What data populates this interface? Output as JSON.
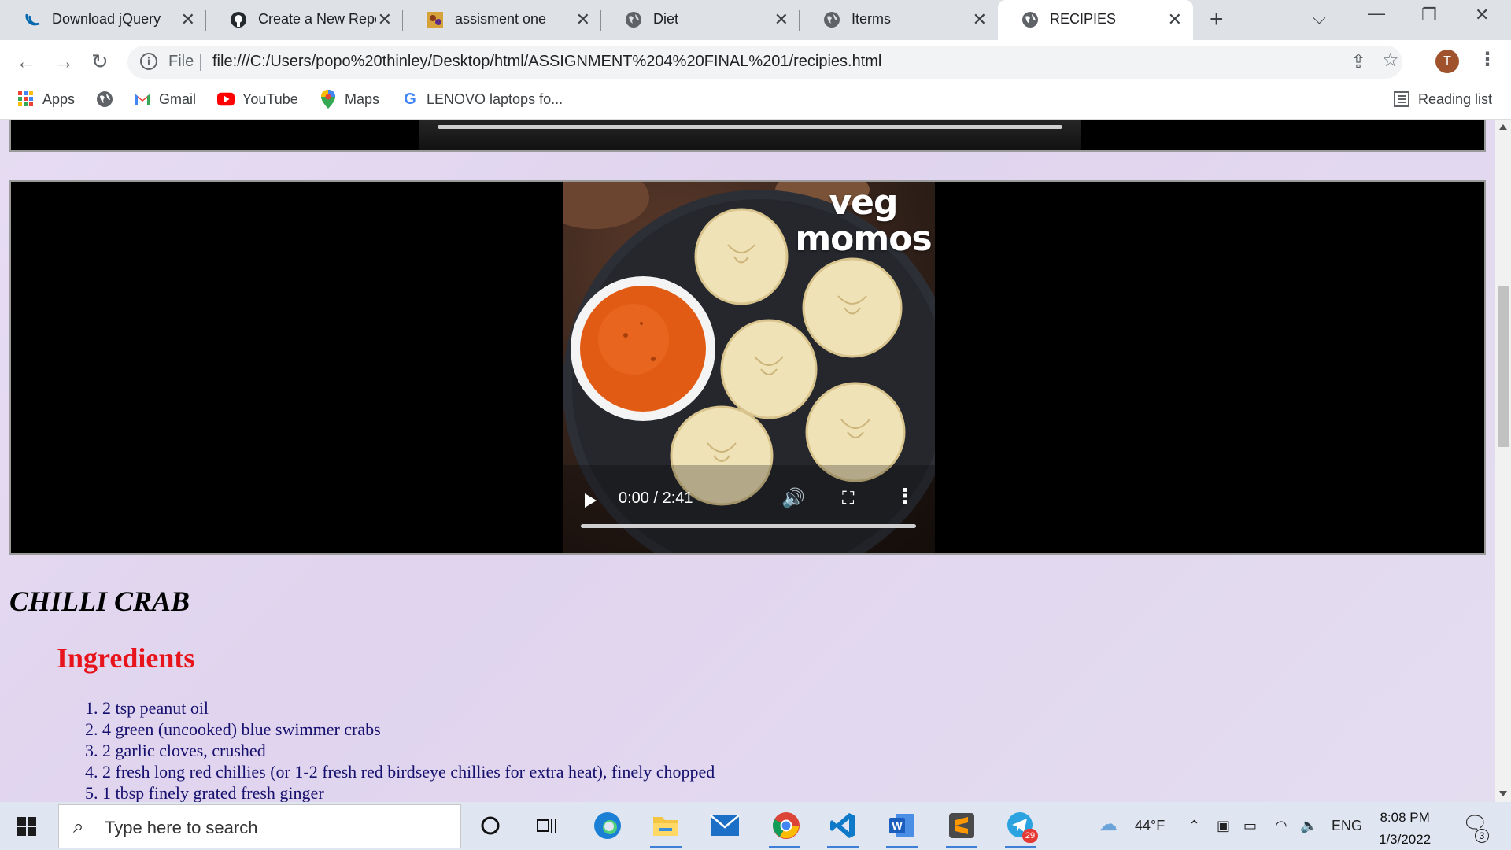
{
  "browser": {
    "tabs": [
      {
        "title": "Download jQuery | ",
        "icon": "jquery-icon"
      },
      {
        "title": "Create a New Repo",
        "icon": "github-icon"
      },
      {
        "title": "assisment one",
        "icon": "image-icon"
      },
      {
        "title": "Diet",
        "icon": "globe-icon"
      },
      {
        "title": "Iterms",
        "icon": "globe-icon"
      },
      {
        "title": "RECIPIES",
        "icon": "globe-icon",
        "active": true
      }
    ],
    "new_tab_label": "+",
    "address": {
      "scheme": "File",
      "url": "file:///C:/Users/popo%20thinley/Desktop/html/ASSIGNMENT%204%20FINAL%201/recipies.html"
    },
    "avatar_initial": "T",
    "bookmarks": [
      {
        "label": "Apps",
        "icon": "apps-grid-icon"
      },
      {
        "label": "",
        "icon": "globe-icon"
      },
      {
        "label": "Gmail",
        "icon": "gmail-icon"
      },
      {
        "label": "YouTube",
        "icon": "youtube-icon"
      },
      {
        "label": "Maps",
        "icon": "maps-pin-icon"
      },
      {
        "label": "LENOVO laptops fo...",
        "icon": "google-icon"
      }
    ],
    "reading_list_label": "Reading list"
  },
  "page": {
    "video": {
      "overlay_text_line1": "veg",
      "overlay_text_line2": "momos",
      "time": "0:00 / 2:41"
    },
    "recipe_title": "CHILLI CRAB",
    "ingredients_heading": "Ingredients",
    "ingredients": [
      "1. 2 tsp peanut oil",
      "2. 4 green (uncooked) blue swimmer crabs",
      "3. 2 garlic cloves, crushed",
      "4. 2 fresh long red chillies (or 1-2 fresh red birdseye chillies for extra heat), finely chopped",
      "5. 1 tbsp finely grated fresh ginger"
    ]
  },
  "taskbar": {
    "search_placeholder": "Type here to search",
    "telegram_badge": "29",
    "weather": "44°F",
    "language": "ENG",
    "time": "8:08 PM",
    "date": "1/3/2022",
    "notification_count": "3"
  }
}
